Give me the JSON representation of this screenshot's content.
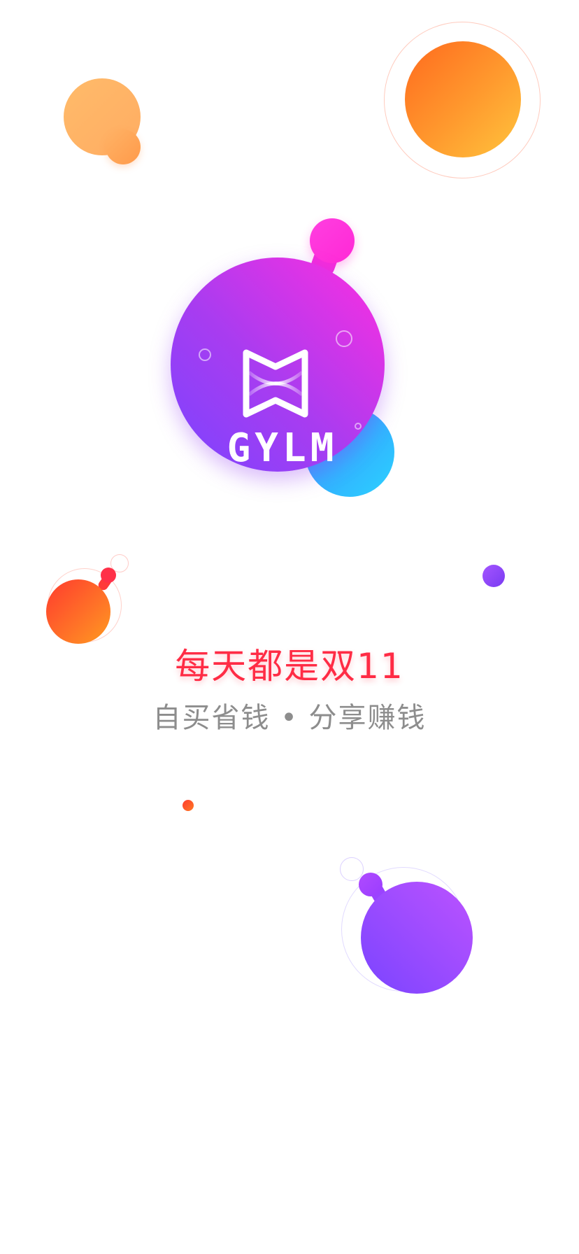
{
  "app": {
    "logo_text": "GYLM"
  },
  "splash": {
    "headline": "每天都是双11",
    "subheadline": "自买省钱 • 分享赚钱"
  },
  "colors": {
    "headline": "#ff2c45",
    "subheadline": "#8d8d8d",
    "logo_gradient_start": "#7a44ff",
    "logo_gradient_end": "#ff2ee0",
    "accent_blue": "#2bd2ff",
    "accent_orange": "#ff9a2e"
  }
}
